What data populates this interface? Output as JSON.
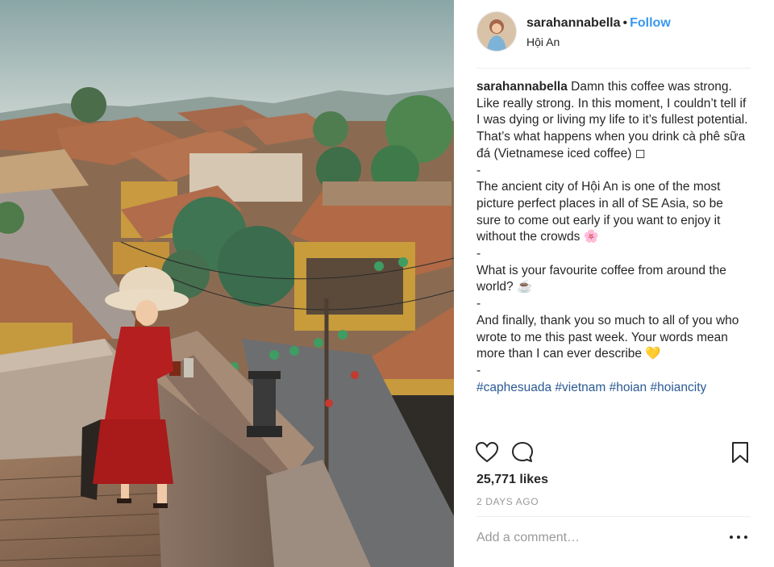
{
  "header": {
    "username": "sarahannabella",
    "separator": "•",
    "follow_label": "Follow",
    "location": "Hội An"
  },
  "caption": {
    "username": "sarahannabella",
    "paragraph_1": " Damn this coffee was strong. Like really strong. In this moment, I couldn’t tell if I was dying or living my life to it’s fullest potential. That’s what happens when you drink cà phê sữa đá (Vietnamese iced coffee) ◻",
    "sep_1": "-",
    "paragraph_2": "The ancient city of Hội An is one of the most picture perfect places in all of SE Asia, so be sure to come out early if you want to enjoy it without the crowds 🌸",
    "sep_2": "-",
    "paragraph_3": "What is your favourite coffee from around the world? ☕",
    "sep_3": "-",
    "paragraph_4": "And finally, thank you so much to all of you who wrote to me this past week. Your words mean more than I can ever describe 💛",
    "sep_4": "-",
    "hashtags": [
      "#caphesuada",
      "#vietnam",
      "#hoian",
      "#hoiancity"
    ]
  },
  "actions": {
    "like_icon": "heart-outline-icon",
    "comment_icon": "speech-bubble-icon",
    "save_icon": "bookmark-outline-icon"
  },
  "likes_text": "25,771 likes",
  "date_text": "2 DAYS AGO",
  "comment_placeholder": "Add a comment…",
  "more_icon": "ellipsis-icon",
  "colors": {
    "link_blue": "#3897f0",
    "hashtag_blue": "#2b5a94",
    "muted_gray": "#999999",
    "dress_red": "#b51f1f"
  }
}
